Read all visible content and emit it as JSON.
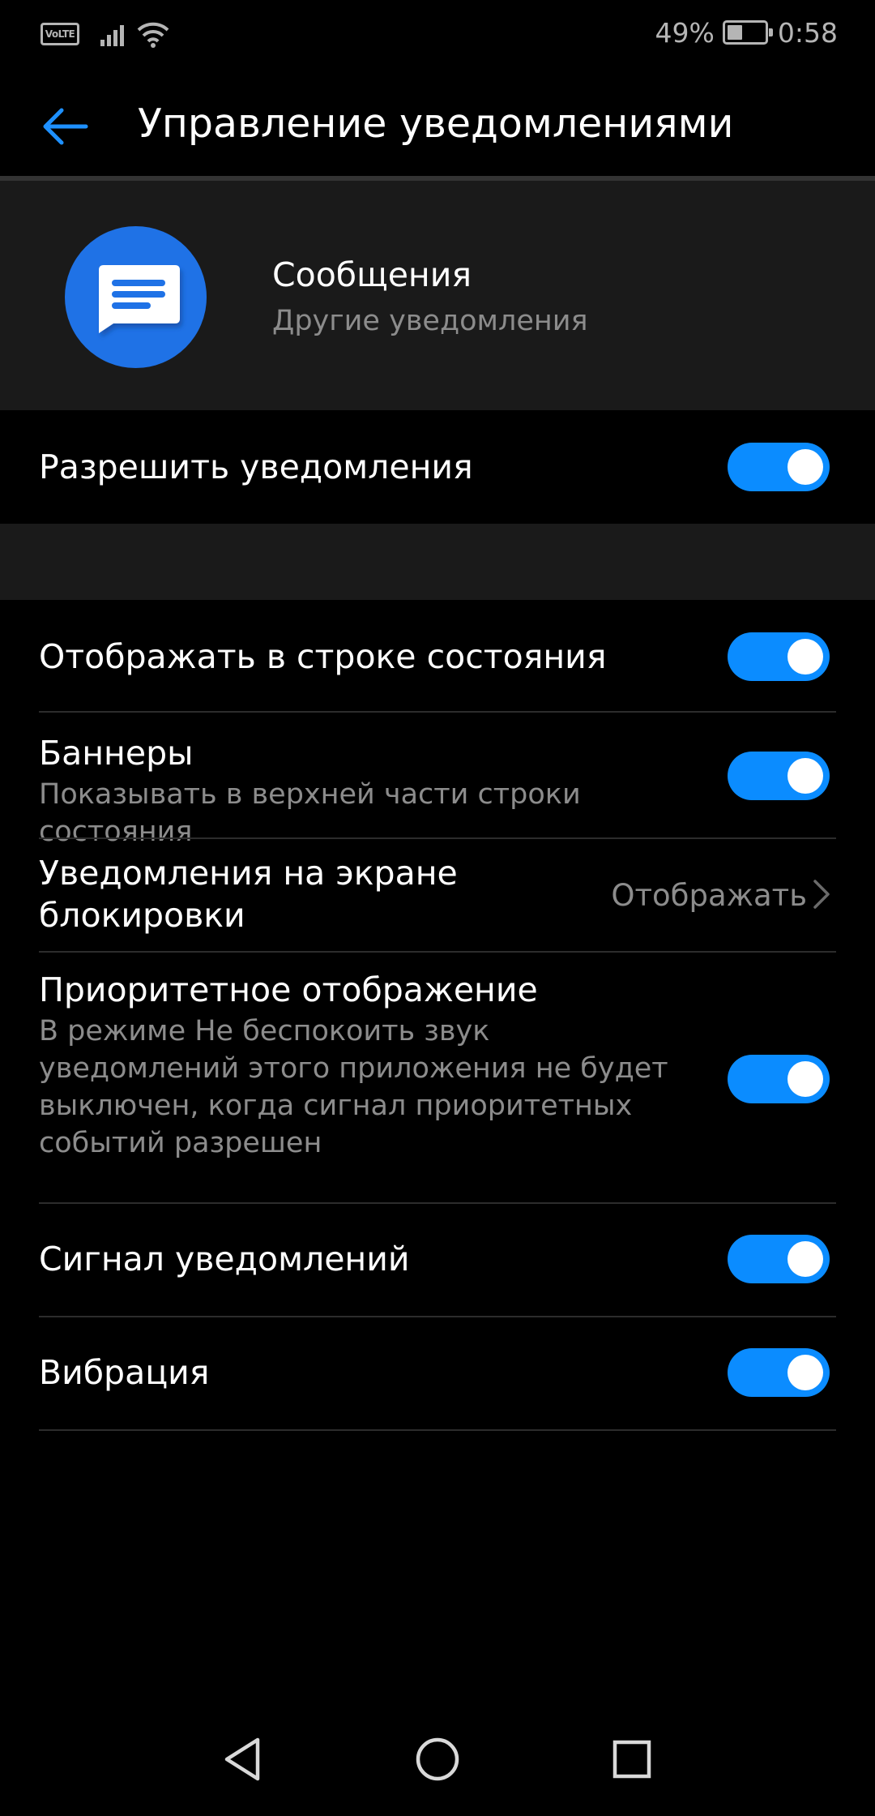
{
  "status_bar": {
    "volte_label": "VoLTE",
    "battery_percent": "49%",
    "battery_level": 0.49,
    "time": "0:58",
    "icons": [
      "volte-icon",
      "signal-icon",
      "wifi-icon",
      "battery-icon"
    ]
  },
  "header": {
    "title": "Управление уведомлениями",
    "back_icon": "back-arrow-icon",
    "accent_color": "#1e90ff"
  },
  "app": {
    "name": "Сообщения",
    "category": "Другие уведомления",
    "icon": "messages-app-icon",
    "icon_color": "#1f72e6"
  },
  "allow": {
    "label": "Разрешить уведомления",
    "enabled": true
  },
  "settings": [
    {
      "id": "status-bar",
      "title": "Отображать в строке состояния",
      "subtitle": "",
      "control": "toggle",
      "enabled": true
    },
    {
      "id": "banners",
      "title": "Баннеры",
      "subtitle": "Показывать в верхней части строки состояния",
      "control": "toggle",
      "enabled": true
    },
    {
      "id": "lock-screen",
      "title": "Уведомления на экране блокировки",
      "subtitle": "",
      "control": "value",
      "value": "Отображать"
    },
    {
      "id": "priority",
      "title": "Приоритетное отображение",
      "subtitle": "В режиме Не беспокоить звук уведомлений этого приложения не будет выключен, когда сигнал приоритетных событий разрешен",
      "control": "toggle",
      "enabled": true
    },
    {
      "id": "sound",
      "title": "Сигнал уведомлений",
      "subtitle": "",
      "control": "toggle",
      "enabled": true
    },
    {
      "id": "vibration",
      "title": "Вибрация",
      "subtitle": "",
      "control": "toggle",
      "enabled": true
    }
  ],
  "toggle_on_color": "#0b8cff",
  "nav": {
    "icons": [
      "nav-back-icon",
      "nav-home-icon",
      "nav-recents-icon"
    ]
  }
}
